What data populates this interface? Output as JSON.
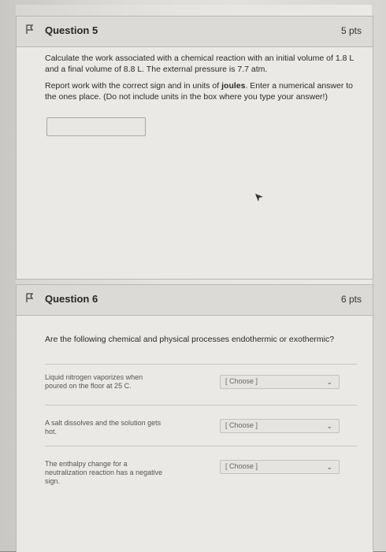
{
  "question5": {
    "title": "Question 5",
    "points": "5 pts",
    "text1": "Calculate the work associated with a chemical reaction with an initial volume of 1.8 L and a final volume of 8.8 L. The external pressure is 7.7 atm.",
    "text2_a": "Report work with the correct sign and in units of ",
    "text2_bold": "joules",
    "text2_b": ". Enter a numerical answer to the ones place. (Do not include units in the box where you type your answer!)",
    "answer_value": ""
  },
  "question6": {
    "title": "Question 6",
    "points": "6 pts",
    "prompt": "Are the following chemical and physical processes endothermic or exothermic?",
    "items": [
      {
        "statement": "Liquid nitrogen vaporizes when poured on the floor at 25 C.",
        "select": "[ Choose ]"
      },
      {
        "statement": "A salt dissolves and the solution gets hot.",
        "select": "[ Choose ]"
      },
      {
        "statement": "The enthalpy change for a neutralization reaction has a negative sign.",
        "select": "[ Choose ]"
      }
    ]
  },
  "icons": [
    "flag-icon",
    "cursor-icon",
    "chevron-down-icon"
  ],
  "colors": {
    "card": "#ebe9e6",
    "header": "#dcdad7",
    "border": "#b9b7b4"
  }
}
